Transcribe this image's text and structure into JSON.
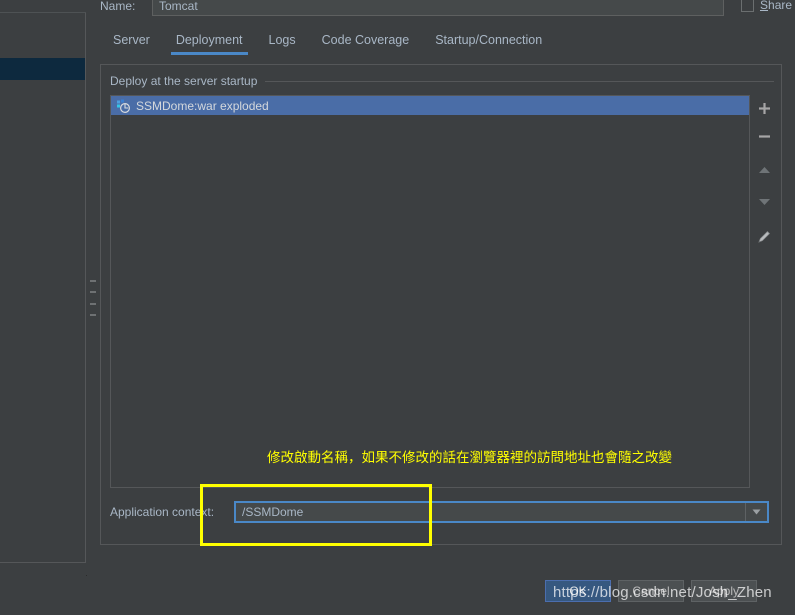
{
  "window": {
    "name_label": "Name:",
    "name_value": "Tomcat",
    "share_label": "Share"
  },
  "tabs": [
    {
      "label": "Server",
      "active": false
    },
    {
      "label": "Deployment",
      "active": true
    },
    {
      "label": "Logs",
      "active": false
    },
    {
      "label": "Code Coverage",
      "active": false
    },
    {
      "label": "Startup/Connection",
      "active": false
    }
  ],
  "deployment": {
    "section_title": "Deploy at the server startup",
    "artifacts": [
      {
        "name": "SSMDome:war exploded",
        "icon": "artifact-icon",
        "selected": true
      }
    ],
    "toolbar": [
      {
        "name": "add-button",
        "glyph": "+"
      },
      {
        "name": "remove-button",
        "glyph": "−"
      },
      {
        "name": "move-up-button",
        "glyph": "▲"
      },
      {
        "name": "move-down-button",
        "glyph": "▼"
      },
      {
        "name": "edit-button",
        "glyph": "✎"
      }
    ],
    "application_context": {
      "label": "Application context:",
      "value": "/SSMDome",
      "dropdown_icon": "chevron-down-icon"
    }
  },
  "annotation": {
    "text": "修改啟動名稱，如果不修改的話在瀏覽器裡的訪問地址也會隨之改變",
    "color": "#ffff00"
  },
  "buttons": [
    {
      "label": "OK",
      "style": "primary"
    },
    {
      "label": "Cancel",
      "style": "default"
    },
    {
      "label": "Apply",
      "style": "default"
    }
  ],
  "watermark": {
    "text": "https://blog.csdn.net/Josh_Zhen"
  },
  "colors": {
    "background": "#3c3f41",
    "selection": "#4a6da7",
    "tree_selection": "#0d293e",
    "accent": "#4a88c7",
    "highlight": "#ffff00",
    "text": "#a9b7c6"
  }
}
